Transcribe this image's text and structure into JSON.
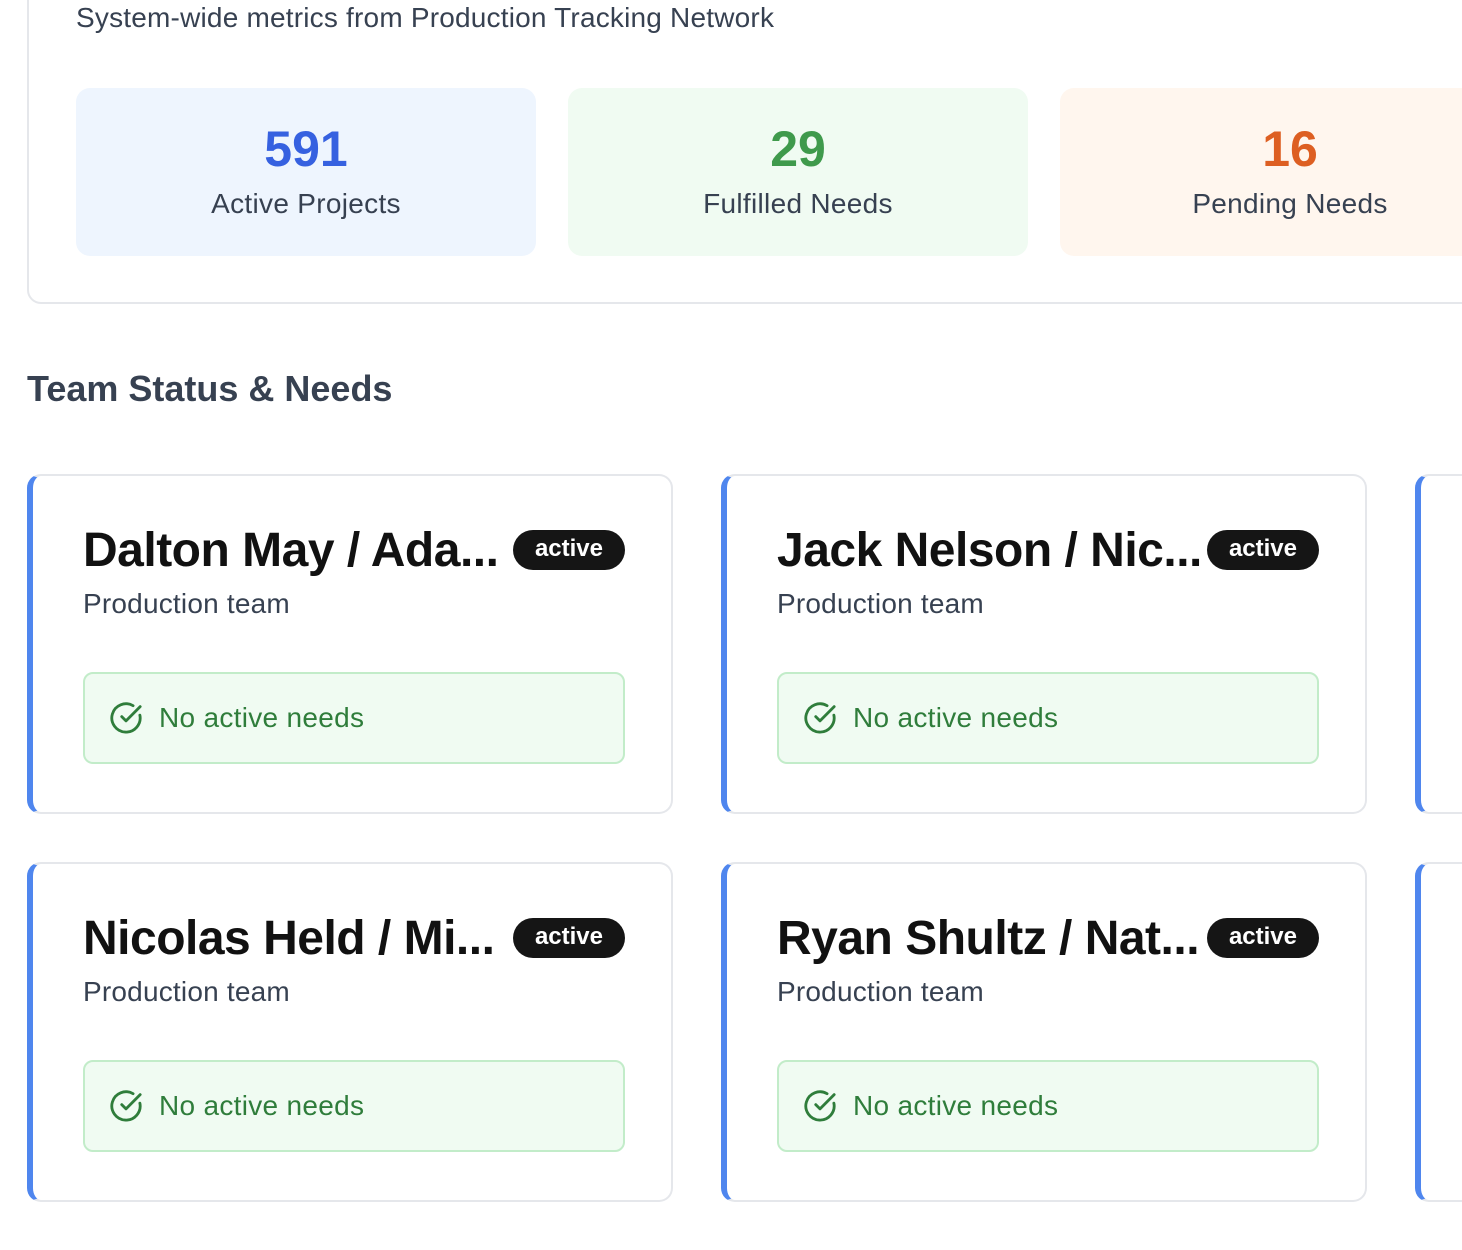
{
  "metrics": {
    "subtitle": "System-wide metrics from Production Tracking Network",
    "stats": [
      {
        "value": "591",
        "label": "Active Projects",
        "color": "#3661e0"
      },
      {
        "value": "29",
        "label": "Fulfilled Needs",
        "color": "#3f9a4c"
      },
      {
        "value": "16",
        "label": "Pending Needs",
        "color": "#dd5f22"
      }
    ]
  },
  "team_section": {
    "title": "Team Status & Needs",
    "accent_color": "#4f86ee",
    "teams": [
      {
        "name": "Dalton May / Ada...",
        "status": "active",
        "type": "Production team",
        "needs": "No active needs"
      },
      {
        "name": "Jack Nelson / Nic...",
        "status": "active",
        "type": "Production team",
        "needs": "No active needs"
      },
      {
        "name": "Nicolas Held / Mi...",
        "status": "active",
        "type": "Production team",
        "needs": "No active needs"
      },
      {
        "name": "Ryan Shultz / Nat...",
        "status": "active",
        "type": "Production team",
        "needs": "No active needs"
      }
    ],
    "needs_icon": "check-circle-icon"
  }
}
